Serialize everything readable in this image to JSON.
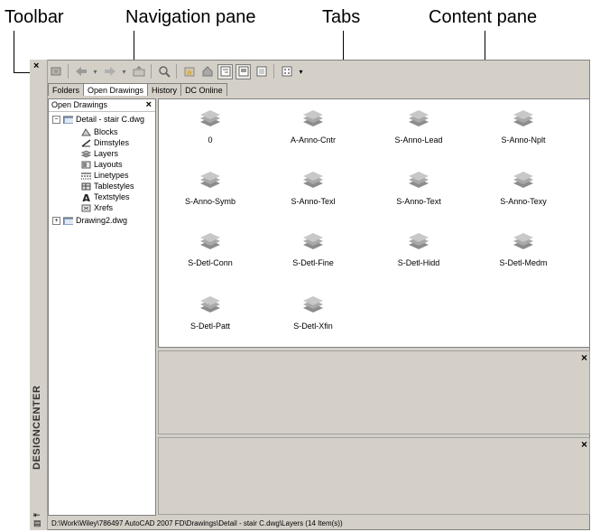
{
  "callouts": {
    "toolbar": "Toolbar",
    "navigation_pane": "Navigation pane",
    "tabs": "Tabs",
    "content_pane": "Content pane"
  },
  "designcenter": {
    "title": "DESIGNCENTER",
    "close_glyph": "×"
  },
  "tabs": [
    "Folders",
    "Open Drawings",
    "History",
    "DC Online"
  ],
  "nav": {
    "header": "Open Drawings",
    "close_glyph": "×",
    "tree": {
      "drawing1": "Detail - stair C.dwg",
      "children": [
        "Blocks",
        "Dimstyles",
        "Layers",
        "Layouts",
        "Linetypes",
        "Tablestyles",
        "Textstyles",
        "Xrefs"
      ],
      "drawing2": "Drawing2.dwg"
    }
  },
  "content": {
    "items": [
      "0",
      "A-Anno-Cntr",
      "S-Anno-Lead",
      "S-Anno-Nplt",
      "S-Anno-Symb",
      "S-Anno-Texl",
      "S-Anno-Text",
      "S-Anno-Texy",
      "S-Detl-Conn",
      "S-Detl-Fine",
      "S-Detl-Hidd",
      "S-Detl-Medm",
      "S-Detl-Patt",
      "S-Detl-Xfin"
    ]
  },
  "panels": {
    "close_glyph": "×"
  },
  "status": "D:\\Work\\Wiley\\786497 AutoCAD 2007 FD\\Drawings\\Detail - stair C.dwg\\Layers (14 Item(s))"
}
